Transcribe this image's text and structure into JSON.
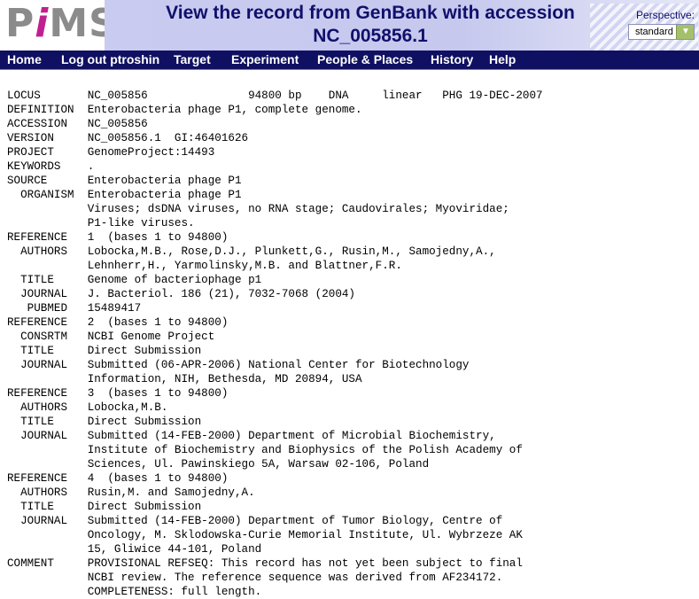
{
  "logo": {
    "text_p": "P",
    "text_i": "i",
    "text_ms": "MS"
  },
  "page": {
    "title_line1": "View the record from GenBank with accession",
    "title_line2": "NC_005856.1"
  },
  "perspective": {
    "label": "Perspective:",
    "selected": "standard"
  },
  "nav": {
    "items": [
      "Home",
      "Log out ptroshin",
      "Target",
      "Experiment",
      "People & Places",
      "History",
      "Help"
    ]
  },
  "record": {
    "lines": [
      "LOCUS       NC_005856               94800 bp    DNA     linear   PHG 19-DEC-2007",
      "DEFINITION  Enterobacteria phage P1, complete genome.",
      "ACCESSION   NC_005856",
      "VERSION     NC_005856.1  GI:46401626",
      "PROJECT     GenomeProject:14493",
      "KEYWORDS    .",
      "SOURCE      Enterobacteria phage P1",
      "  ORGANISM  Enterobacteria phage P1",
      "            Viruses; dsDNA viruses, no RNA stage; Caudovirales; Myoviridae;",
      "            P1-like viruses.",
      "REFERENCE   1  (bases 1 to 94800)",
      "  AUTHORS   Lobocka,M.B., Rose,D.J., Plunkett,G., Rusin,M., Samojedny,A.,",
      "            Lehnherr,H., Yarmolinsky,M.B. and Blattner,F.R.",
      "  TITLE     Genome of bacteriophage p1",
      "  JOURNAL   J. Bacteriol. 186 (21), 7032-7068 (2004)",
      "   PUBMED   15489417",
      "REFERENCE   2  (bases 1 to 94800)",
      "  CONSRTM   NCBI Genome Project",
      "  TITLE     Direct Submission",
      "  JOURNAL   Submitted (06-APR-2006) National Center for Biotechnology",
      "            Information, NIH, Bethesda, MD 20894, USA",
      "REFERENCE   3  (bases 1 to 94800)",
      "  AUTHORS   Lobocka,M.B.",
      "  TITLE     Direct Submission",
      "  JOURNAL   Submitted (14-FEB-2000) Department of Microbial Biochemistry,",
      "            Institute of Biochemistry and Biophysics of the Polish Academy of",
      "            Sciences, Ul. Pawinskiego 5A, Warsaw 02-106, Poland",
      "REFERENCE   4  (bases 1 to 94800)",
      "  AUTHORS   Rusin,M. and Samojedny,A.",
      "  TITLE     Direct Submission",
      "  JOURNAL   Submitted (14-FEB-2000) Department of Tumor Biology, Centre of",
      "            Oncology, M. Sklodowska-Curie Memorial Institute, Ul. Wybrzeze AK",
      "            15, Gliwice 44-101, Poland",
      "COMMENT     PROVISIONAL REFSEQ: This record has not yet been subject to final",
      "            NCBI review. The reference sequence was derived from AF234172.",
      "            COMPLETENESS: full length."
    ]
  }
}
